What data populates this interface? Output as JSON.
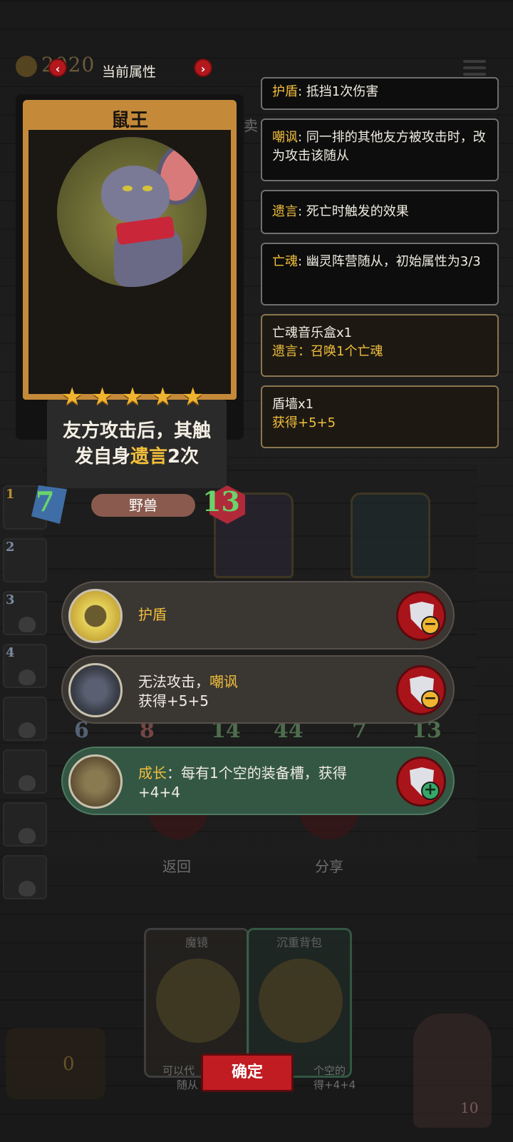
{
  "topbar": {
    "gold": "2020",
    "title": "当前属性",
    "prev": "‹",
    "next": "›"
  },
  "hero": {
    "name": "鼠王",
    "stars": 5,
    "desc_part1": "友方攻击后，其触",
    "desc_part2": "发自身",
    "desc_keyword": "遗言",
    "desc_part3": "2次",
    "attack": "7",
    "health": "13",
    "tribe": "野兽"
  },
  "keywords": [
    {
      "name": "护盾",
      "sep": ": ",
      "text": "抵挡1次伤害"
    },
    {
      "name": "嘲讽",
      "sep": ": ",
      "text": "同一排的其他友方被攻击时，改为攻击该随从"
    },
    {
      "name": "遗言",
      "sep": ": ",
      "text": "死亡时触发的效果"
    },
    {
      "name": "亡魂",
      "sep": ": ",
      "text": "幽灵阵营随从，初始属性为3/3"
    }
  ],
  "items": [
    {
      "title": "亡魂音乐盒x1",
      "line": "遗言：召唤1个亡魂"
    },
    {
      "title": "盾墙x1",
      "line": "获得+5+5"
    }
  ],
  "buffs": [
    {
      "line1_prefix": "",
      "line1_keyword": "护盾",
      "line2": "",
      "action": "−",
      "style": "neutral"
    },
    {
      "line1_prefix": "无法攻击，",
      "line1_keyword": "嘲讽",
      "line2": "获得+5+5",
      "action": "−",
      "style": "neutral"
    },
    {
      "line1_keyword": "成长",
      "line1_rest": "：每有1个空的装备槽，获得",
      "line2": "+4+4",
      "action": "+",
      "style": "green"
    }
  ],
  "background": {
    "back_label": "返回",
    "share_label": "分享",
    "slot_numbers": [
      "1",
      "2",
      "3",
      "4"
    ],
    "board_stats": [
      "6",
      "8",
      "14",
      "44",
      "7",
      "13"
    ],
    "shop_cards": [
      {
        "title": "魔镜",
        "foot1": "可以代",
        "foot2": "随从"
      },
      {
        "title": "沉重背包",
        "foot1": "个空的",
        "foot2": "得+4+4"
      }
    ],
    "chest_count": "0",
    "lives": "10",
    "dim_text": "卖"
  },
  "confirm_label": "确定",
  "colors": {
    "keyword": "#f2bf3c",
    "confirm": "#c01c22",
    "buff_green": "#345744",
    "buff_neutral": "#3a3632"
  }
}
